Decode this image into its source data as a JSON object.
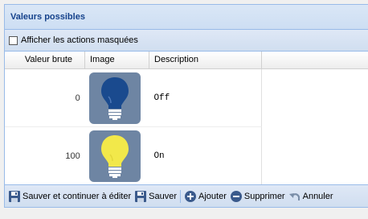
{
  "panel": {
    "title": "Valeurs possibles"
  },
  "filter": {
    "checkbox_label": "Afficher les actions masquées",
    "checked": false
  },
  "grid": {
    "columns": [
      "Valeur brute",
      "Image",
      "Description"
    ],
    "rows": [
      {
        "raw_value": "0",
        "image": "bulb-off-icon",
        "description": "Off"
      },
      {
        "raw_value": "100",
        "image": "bulb-on-icon",
        "description": "On"
      }
    ]
  },
  "toolbar": {
    "save_continue_label": "Sauver et continuer à éditer",
    "save_label": "Sauver",
    "add_label": "Ajouter",
    "delete_label": "Supprimer",
    "cancel_label": "Annuler"
  },
  "colors": {
    "header_text": "#15428b",
    "bulb_off": "#1a4a8e",
    "bulb_on": "#f2e84a",
    "bulb_bg": "#6e85a3"
  }
}
